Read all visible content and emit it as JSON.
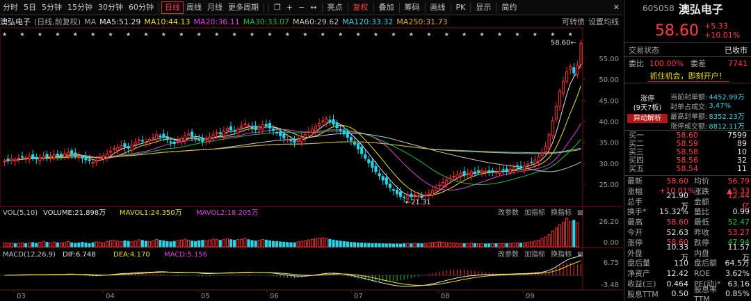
{
  "toolbar": {
    "items": [
      "分时",
      "5日",
      "5分钟",
      "15分钟",
      "30分钟",
      "60分钟",
      "日线",
      "周线",
      "月线",
      "更多周期"
    ],
    "active_index": 6,
    "right_items": [
      "亮点",
      "复权",
      "叠加",
      "筹码",
      "画线",
      "PK",
      "显示",
      "简约"
    ]
  },
  "ma_line": {
    "name": "澳弘电子",
    "mode": "(日线,前复权)",
    "ma_label": "MA",
    "ma": [
      {
        "label": "MA5:51.29",
        "color": "#e6e6e6"
      },
      {
        "label": "MA10:44.13",
        "color": "#f0e020"
      },
      {
        "label": "MA20:36.11",
        "color": "#e040e0"
      },
      {
        "label": "MA30:33.07",
        "color": "#20c040"
      },
      {
        "label": "MA60:29.62",
        "color": "#c8c8c8"
      },
      {
        "label": "MA120:33.32",
        "color": "#39d3e8"
      },
      {
        "label": "MA250:31.73",
        "color": "#e0b030"
      }
    ],
    "right": "可转债",
    "settings": "设置均线"
  },
  "chart_data": {
    "type": "candlestick",
    "x_ticks": [
      "03",
      "04",
      "05",
      "06",
      "07",
      "08",
      "09"
    ],
    "y_ticks": [
      55.0,
      50.0,
      45.0,
      40.0,
      35.0,
      30.0,
      25.0
    ],
    "max_label": "58.60",
    "min_label": "21.31",
    "markers": "★",
    "closes": [
      30.5,
      30.7,
      31.0,
      30.8,
      31.2,
      31.5,
      31.3,
      31.6,
      31.2,
      31.0,
      31.3,
      31.6,
      31.5,
      31.8,
      32.0,
      31.7,
      31.9,
      32.3,
      32.6,
      32.2,
      31.8,
      31.5,
      31.2,
      30.8,
      30.6,
      30.2,
      30.7,
      31.3,
      31.8,
      32.3,
      32.9,
      33.5,
      33.8,
      34.2,
      33.9,
      33.6,
      34.4,
      35.0,
      35.6,
      35.3,
      35.0,
      35.7,
      36.1,
      36.8,
      36.5,
      36.2,
      35.6,
      35.1,
      34.7,
      35.3,
      35.9,
      36.5,
      37.0,
      36.4,
      36.0,
      35.6,
      35.2,
      35.8,
      36.2,
      36.8,
      37.3,
      37.0,
      37.7,
      38.3,
      38.0,
      37.6,
      38.2,
      38.9,
      39.4,
      39.0,
      38.4,
      38.0,
      38.6,
      39.2,
      39.0,
      38.4,
      37.8,
      37.2,
      36.6,
      36.0,
      35.7,
      35.3,
      35.0,
      35.6,
      36.2,
      36.8,
      37.5,
      38.1,
      38.8,
      39.5,
      40.1,
      40.6,
      40.0,
      39.3,
      38.5,
      37.8,
      37.0,
      36.2,
      35.4,
      34.5,
      33.4,
      32.3,
      31.2,
      30.1,
      29.0,
      28.0,
      27.0,
      26.0,
      25.0,
      24.2,
      23.5,
      22.7,
      22.1,
      21.8,
      22.3,
      22.0,
      22.5,
      22.2,
      21.9,
      22.4,
      22.9,
      23.5,
      24.1,
      24.8,
      25.4,
      26.0,
      26.5,
      26.9,
      27.3,
      27.6,
      27.2,
      27.6,
      28.0,
      27.7,
      28.0,
      28.3,
      28.0,
      27.8,
      28.1,
      27.9,
      28.1,
      28.4,
      28.2,
      28.6,
      28.9,
      29.3,
      29.0,
      29.4,
      29.8,
      30.2,
      30.8,
      31.5,
      32.4,
      34.0,
      36.8,
      40.1,
      43.5,
      47.2,
      49.5,
      51.8,
      53.0,
      51.5,
      53.3,
      58.6
    ],
    "volumes": [
      3.5,
      3.2,
      3.4,
      3.0,
      3.3,
      3.6,
      3.1,
      3.5,
      3.9,
      3.2,
      4.2,
      5.0,
      4.1,
      3.6,
      4.4,
      3.7,
      3.4,
      3.9,
      4.8,
      3.7,
      3.2,
      3.6,
      4.1,
      3.5,
      3.0,
      3.8,
      4.5,
      4.0,
      3.6,
      4.9,
      5.8,
      6.1,
      5.2,
      4.7,
      5.5,
      5.0,
      4.6,
      5.2,
      6.4,
      5.8,
      5.1,
      4.7,
      5.6,
      6.8,
      6.0,
      5.4,
      4.8,
      4.5,
      5.0,
      5.6,
      6.2,
      7.0,
      6.1,
      5.3,
      4.9,
      5.5,
      6.0,
      5.4,
      6.3,
      7.1,
      6.6,
      6.0,
      6.9,
      7.4,
      6.5,
      6.0,
      6.6,
      7.0,
      7.8,
      6.5,
      5.8,
      5.3,
      5.9,
      6.7,
      6.2,
      5.6,
      5.0,
      4.8,
      4.5,
      4.2,
      4.0,
      3.8,
      3.7,
      4.5,
      5.0,
      5.6,
      6.3,
      6.8,
      7.4,
      7.9,
      8.3,
      7.6,
      6.9,
      6.2,
      5.7,
      5.2,
      4.8,
      4.4,
      4.0,
      3.9,
      3.6,
      3.5,
      3.3,
      3.2,
      3.0,
      3.1,
      2.9,
      2.8,
      2.7,
      2.8,
      2.6,
      2.7,
      2.5,
      2.9,
      3.2,
      2.8,
      3.3,
      3.0,
      2.8,
      3.1,
      3.6,
      3.9,
      4.2,
      4.5,
      4.1,
      3.8,
      3.6,
      3.4,
      3.2,
      3.0,
      2.9,
      3.1,
      3.3,
      3.0,
      2.8,
      2.9,
      2.7,
      2.8,
      3.0,
      2.9,
      2.8,
      3.1,
      3.0,
      3.2,
      3.4,
      3.6,
      3.3,
      3.7,
      4.0,
      4.5,
      5.2,
      6.0,
      7.4,
      9.0,
      11.3,
      14.5,
      17.2,
      20.1,
      22.5,
      26.2,
      23.0,
      24.4,
      21.9
    ],
    "vol_ticks": [
      "26.20",
      "0.00"
    ],
    "macd_ticks": [
      "6.75",
      "-3.48"
    ],
    "vol_label": "VOL(5,10)",
    "vol_items": [
      {
        "label": "VOLUME:21.898万",
        "color": "#e6e6e6"
      },
      {
        "label": "MAVOL1:24.350万",
        "color": "#f0e020"
      },
      {
        "label": "MAVOL2:18.205万",
        "color": "#e040e0"
      }
    ],
    "macd_label": "MACD(12,26,9)",
    "macd_items": [
      {
        "label": "DIF:6.748",
        "color": "#e6e6e6"
      },
      {
        "label": "DEA:4.170",
        "color": "#f0e020"
      },
      {
        "label": "MACD:5.156",
        "color": "#e040e0"
      }
    ],
    "sub_btns": [
      "改参数",
      "加指标",
      "换指标"
    ]
  },
  "quote": {
    "code": "605058",
    "name": "澳弘电子",
    "price": "58.60",
    "change": "+5.33",
    "pct": "+10.01%",
    "status_label": "交易状态",
    "status": "已收市",
    "wb_label": "委比",
    "wb": "100.00%",
    "wc_label": "委差",
    "wc": "7741",
    "banner": "抓住机会，即刻开户！",
    "limit_tag": "涨停",
    "limit_days": "(9天7板)",
    "limit_btn": "异动解析",
    "limit_info": [
      [
        "当前封单额:",
        "4452.99万"
      ],
      [
        "封单占成交:",
        "3.47%"
      ],
      [
        "最高封单额:",
        "8352.23万"
      ],
      [
        "涨停成交额:",
        "8812.11万"
      ]
    ],
    "buy": [
      [
        "买一",
        "58.60",
        "7599"
      ],
      [
        "买二",
        "58.59",
        "89"
      ],
      [
        "买三",
        "58.58",
        "10"
      ],
      [
        "买四",
        "58.56",
        "32"
      ],
      [
        "买五",
        "58.54",
        "11"
      ]
    ],
    "stats": [
      [
        "最新",
        "58.60",
        "均价",
        "56.79"
      ],
      [
        "涨幅",
        "+10.01%",
        "涨跌",
        "▲5.33"
      ],
      [
        "总手",
        "21.90万",
        "金额",
        "12.44亿"
      ],
      [
        "换手*",
        "15.32%",
        "量比",
        "0.99"
      ],
      [
        "最高",
        "58.60",
        "最低",
        "52.47"
      ],
      [
        "今开",
        "52.63",
        "昨收",
        "53.27"
      ],
      [
        "涨停",
        "58.60",
        "跌停",
        "47.94"
      ],
      [
        "外盘",
        "10.33万",
        "内盘",
        "11.57万"
      ],
      [
        "盘后量",
        "110",
        "盘后额",
        "64.5万"
      ],
      [
        "净资产",
        "12.42",
        "ROE",
        "3.62%"
      ],
      [
        "收益(三)",
        "0.464",
        "PE(动)*",
        "63.16"
      ],
      [
        "股息TTM",
        "0.50",
        "股息率TTM",
        "0.85%"
      ]
    ]
  }
}
